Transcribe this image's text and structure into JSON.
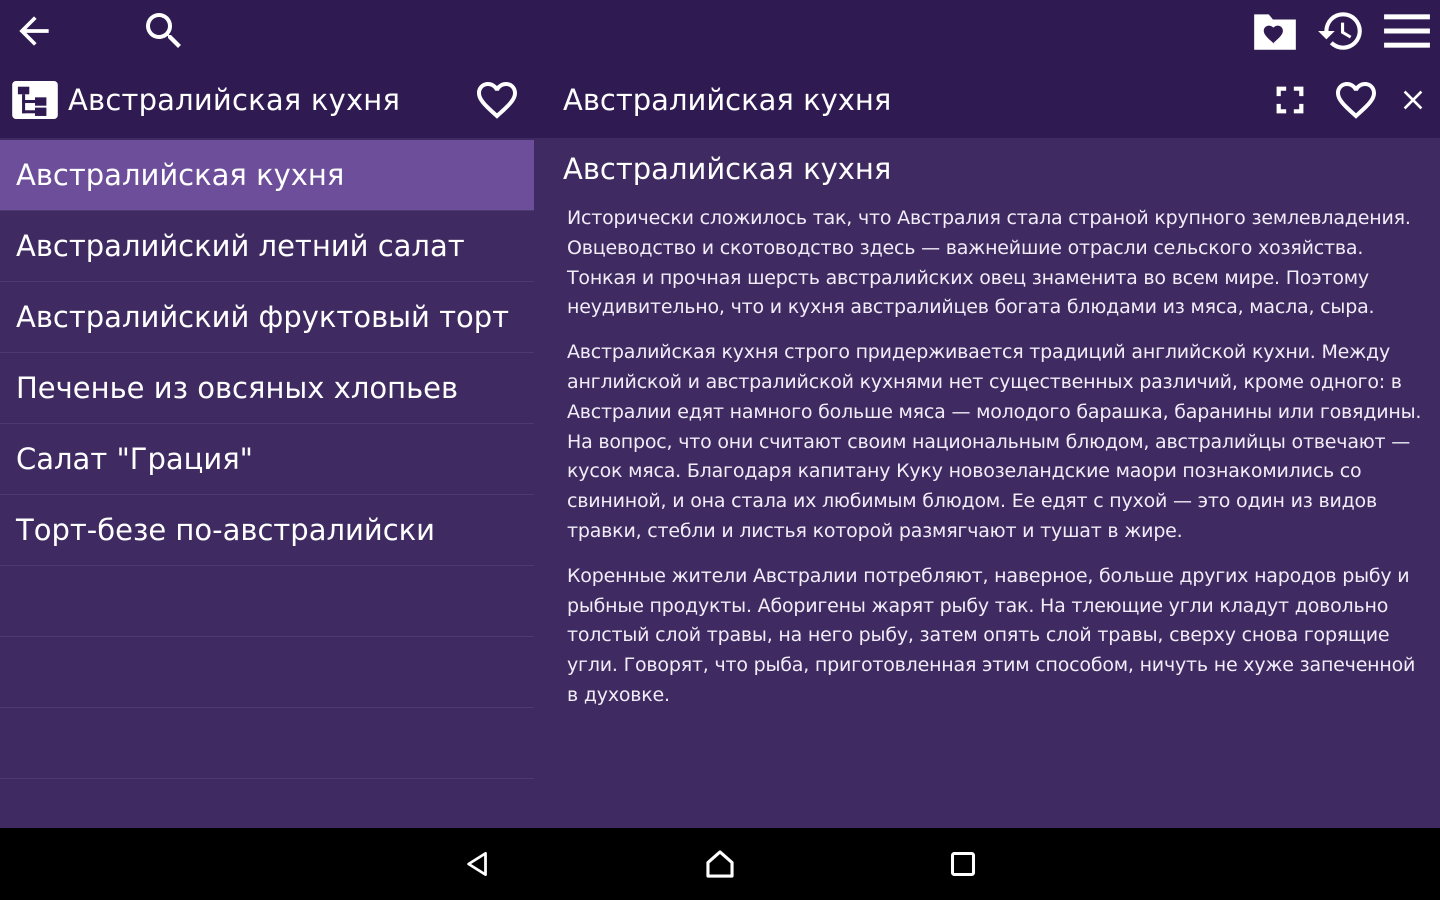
{
  "topbar": {
    "icons": [
      "back-arrow-icon",
      "search-icon",
      "favorites-folder-icon",
      "history-icon",
      "menu-icon"
    ]
  },
  "list_header": {
    "title": "Австралийская кухня"
  },
  "list": {
    "items": [
      {
        "label": "Австралийская кухня",
        "selected": true
      },
      {
        "label": "Австралийский летний салат",
        "selected": false
      },
      {
        "label": "Австралийский фруктовый торт",
        "selected": false
      },
      {
        "label": "Печенье из овсяных хлопьев",
        "selected": false
      },
      {
        "label": "Салат \"Грация\"",
        "selected": false
      },
      {
        "label": "Торт-безе по-австралийски",
        "selected": false
      }
    ]
  },
  "detail": {
    "title": "Австралийская кухня",
    "heading": "Австралийская кухня",
    "paragraphs": [
      "Исторически сложилось так, что Австралия стала страной крупного землевладения. Овцеводство и скотоводство здесь — важнейшие отрасли сельского хозяйства. Тонкая и прочная шерсть австралийских овец знаменита во всем мире. Поэтому неудивительно, что и кухня австралийцев богата блюдами из мяса, масла, сыра.",
      "Австралийская кухня строго придерживается традиций английской кухни. Между английской и австралийской кухнями нет существенных различий, кроме одного: в Австралии едят намного больше мяса — молодого барашка, баранины или говядины. На вопрос, что они считают своим национальным блюдом, австралийцы отвечают — кусок мяса. Благодаря капитану Куку новозеландские маори познакомились со свининой, и она стала их любимым блюдом. Ее едят с пухой — это один из видов травки, стебли и листья которой размягчают и тушат в жире.",
      "Коренные жители Австралии потребляют, наверное, больше других народов рыбу и рыбные продукты. Аборигены жарят рыбу так. На тлеющие угли кладут довольно толстый слой травы, на него рыбу, затем опять слой травы, сверху снова горящие угли. Говорят, что рыба, приготовленная этим способом, ничуть не хуже запеченной в духовке."
    ]
  },
  "navbar": {
    "icons": [
      "back-triangle-icon",
      "home-icon",
      "recents-square-icon"
    ]
  },
  "colors": {
    "topbar_bg": "#2f1a52",
    "pane_bg": "#3f2b61",
    "selected_bg": "#6d4e9a",
    "navbar_bg": "#000000"
  }
}
